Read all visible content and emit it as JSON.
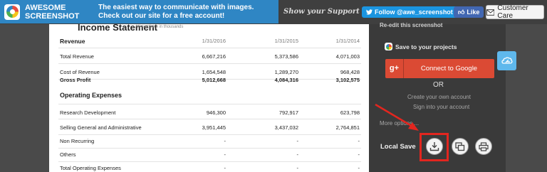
{
  "topbar": {
    "brand_line1": "AWESOME",
    "brand_line2": "SCREENSHOT",
    "tagline_line1": "The easiest way to communicate with images.",
    "tagline_line2": "Check out our site for a free account!",
    "support_text": "Show your Support",
    "twitter_label": "Follow @awe_screenshot",
    "facebook_label": "Like",
    "customer_care_label": "Customer Care"
  },
  "document": {
    "title": "Income Statement",
    "note": "All numbers in thousands",
    "header": {
      "label": "Revenue",
      "dates": [
        "1/31/2016",
        "1/31/2015",
        "1/31/2014"
      ]
    },
    "rows": [
      {
        "label": "Total Revenue",
        "values": [
          "6,667,216",
          "5,373,586",
          "4,071,003"
        ],
        "style": "normal"
      },
      {
        "label": "Cost of Revenue",
        "values": [
          "1,654,548",
          "1,289,270",
          "968,428"
        ],
        "style": "normal"
      },
      {
        "label": "Gross Profit",
        "values": [
          "5,012,668",
          "4,084,316",
          "3,102,575"
        ],
        "style": "bold"
      },
      {
        "label": "Operating Expenses",
        "values": [
          "",
          "",
          ""
        ],
        "style": "section"
      },
      {
        "label": "Research Development",
        "values": [
          "946,300",
          "792,917",
          "623,798"
        ],
        "style": "normal"
      },
      {
        "label": "Selling General and Administrative",
        "values": [
          "3,951,445",
          "3,437,032",
          "2,764,851"
        ],
        "style": "normal"
      },
      {
        "label": "Non Recurring",
        "values": [
          "-",
          "-",
          "-"
        ],
        "style": "normal"
      },
      {
        "label": "Others",
        "values": [
          "-",
          "-",
          "-"
        ],
        "style": "normal"
      },
      {
        "label": "Total Operating Expenses",
        "values": [
          "-",
          "-",
          "-"
        ],
        "style": "normal"
      }
    ]
  },
  "panel": {
    "reedit_label": "Re-edit this screenshot",
    "save_projects_label": "Save to your projects",
    "google_icon_text": "g+",
    "connect_google_label": "Connect to Google",
    "or_label": "OR",
    "create_account_label": "Create your own account",
    "signin_label": "Sign into your account",
    "more_options_label": "More options ...",
    "local_save_label": "Local Save"
  },
  "colors": {
    "brand_blue": "#2f86c4",
    "google_red": "#db4a34",
    "highlight_red": "#e2261f",
    "twitter_blue": "#1b95e0",
    "facebook_blue": "#4267b2"
  },
  "icons": [
    "awesome-screenshot-logo-icon",
    "heart-icon",
    "twitter-bird-icon",
    "facebook-thumb-icon",
    "envelope-icon",
    "google-plus-icon",
    "cloud-share-icon",
    "download-icon",
    "copy-icon",
    "print-icon",
    "pointer-arrow-icon"
  ]
}
